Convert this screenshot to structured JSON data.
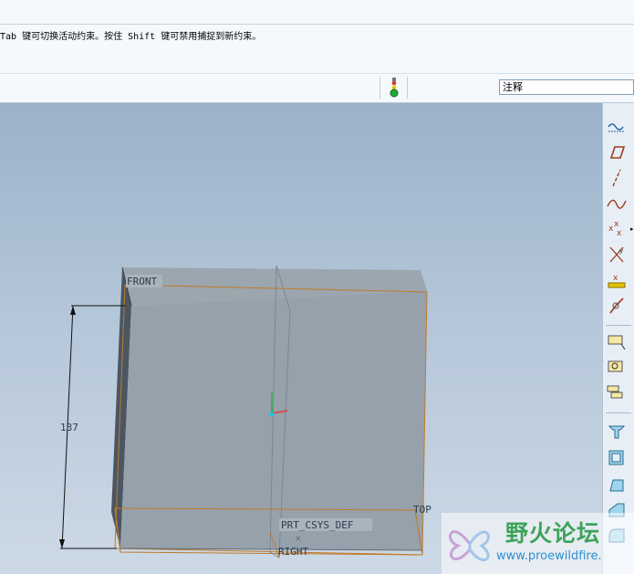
{
  "message_bar": {
    "text": "Tab 键可切换活动约束。按住 Shift 键可禁用捕捉到新约束。"
  },
  "toolbar": {
    "filter_select_value": "注释",
    "status_icon": "traffic-light-icon"
  },
  "viewport": {
    "datum_planes": {
      "front": "FRONT",
      "top": "TOP",
      "right": "RIGHT"
    },
    "csys_label": "PRT_CSYS_DEF",
    "dimension_value": "137",
    "colors": {
      "background_top": "#9bb2c9",
      "background_bottom": "#cdd9e6",
      "solid": "#98a4ae",
      "datum": "#c07a28"
    }
  },
  "right_toolbar": {
    "tools": [
      "datum-analysis-icon",
      "datum-plane-icon",
      "datum-axis-icon",
      "datum-curve-icon",
      "datum-point-icon",
      "coordinate-system-icon",
      "offset-point-icon",
      "connect-icon",
      "annotation-feature-icon",
      "view-annotation-icon",
      "layer-annotation-icon",
      "flange-icon",
      "shell-icon",
      "draft-icon",
      "rib-icon",
      "round-icon"
    ]
  },
  "watermark": {
    "title": "野火论坛",
    "url": "www.proewildfire."
  }
}
